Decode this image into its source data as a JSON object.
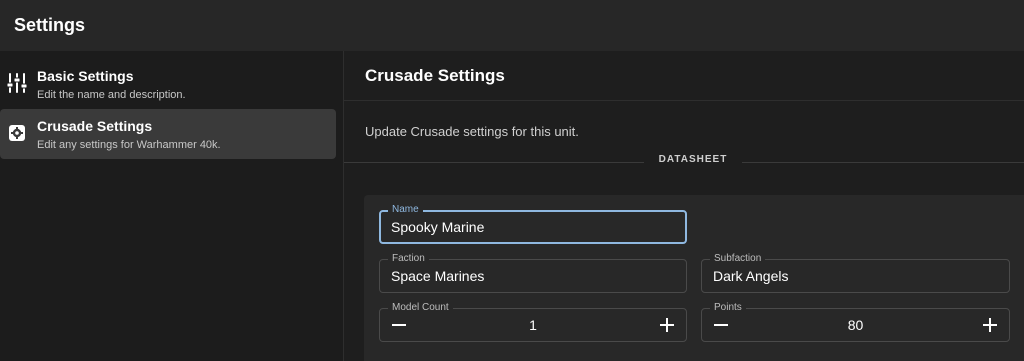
{
  "app": {
    "title": "Settings"
  },
  "sidebar": {
    "items": [
      {
        "label": "Basic Settings",
        "description": "Edit the name and description.",
        "icon": "sliders-icon"
      },
      {
        "label": "Crusade Settings",
        "description": "Edit any settings for Warhammer 40k.",
        "icon": "gear-icon"
      }
    ]
  },
  "main": {
    "title": "Crusade Settings",
    "subtitle": "Update Crusade settings for this unit.",
    "section_label": "DATASHEET"
  },
  "form": {
    "name": {
      "label": "Name",
      "value": "Spooky Marine"
    },
    "faction": {
      "label": "Faction",
      "value": "Space Marines"
    },
    "subfaction": {
      "label": "Subfaction",
      "value": "Dark Angels"
    },
    "model_count": {
      "label": "Model Count",
      "value": "1"
    },
    "points": {
      "label": "Points",
      "value": "80"
    }
  },
  "colors": {
    "focus": "#8fb8e0",
    "active_nav": "#3a3a3a",
    "topbar": "#272727"
  }
}
